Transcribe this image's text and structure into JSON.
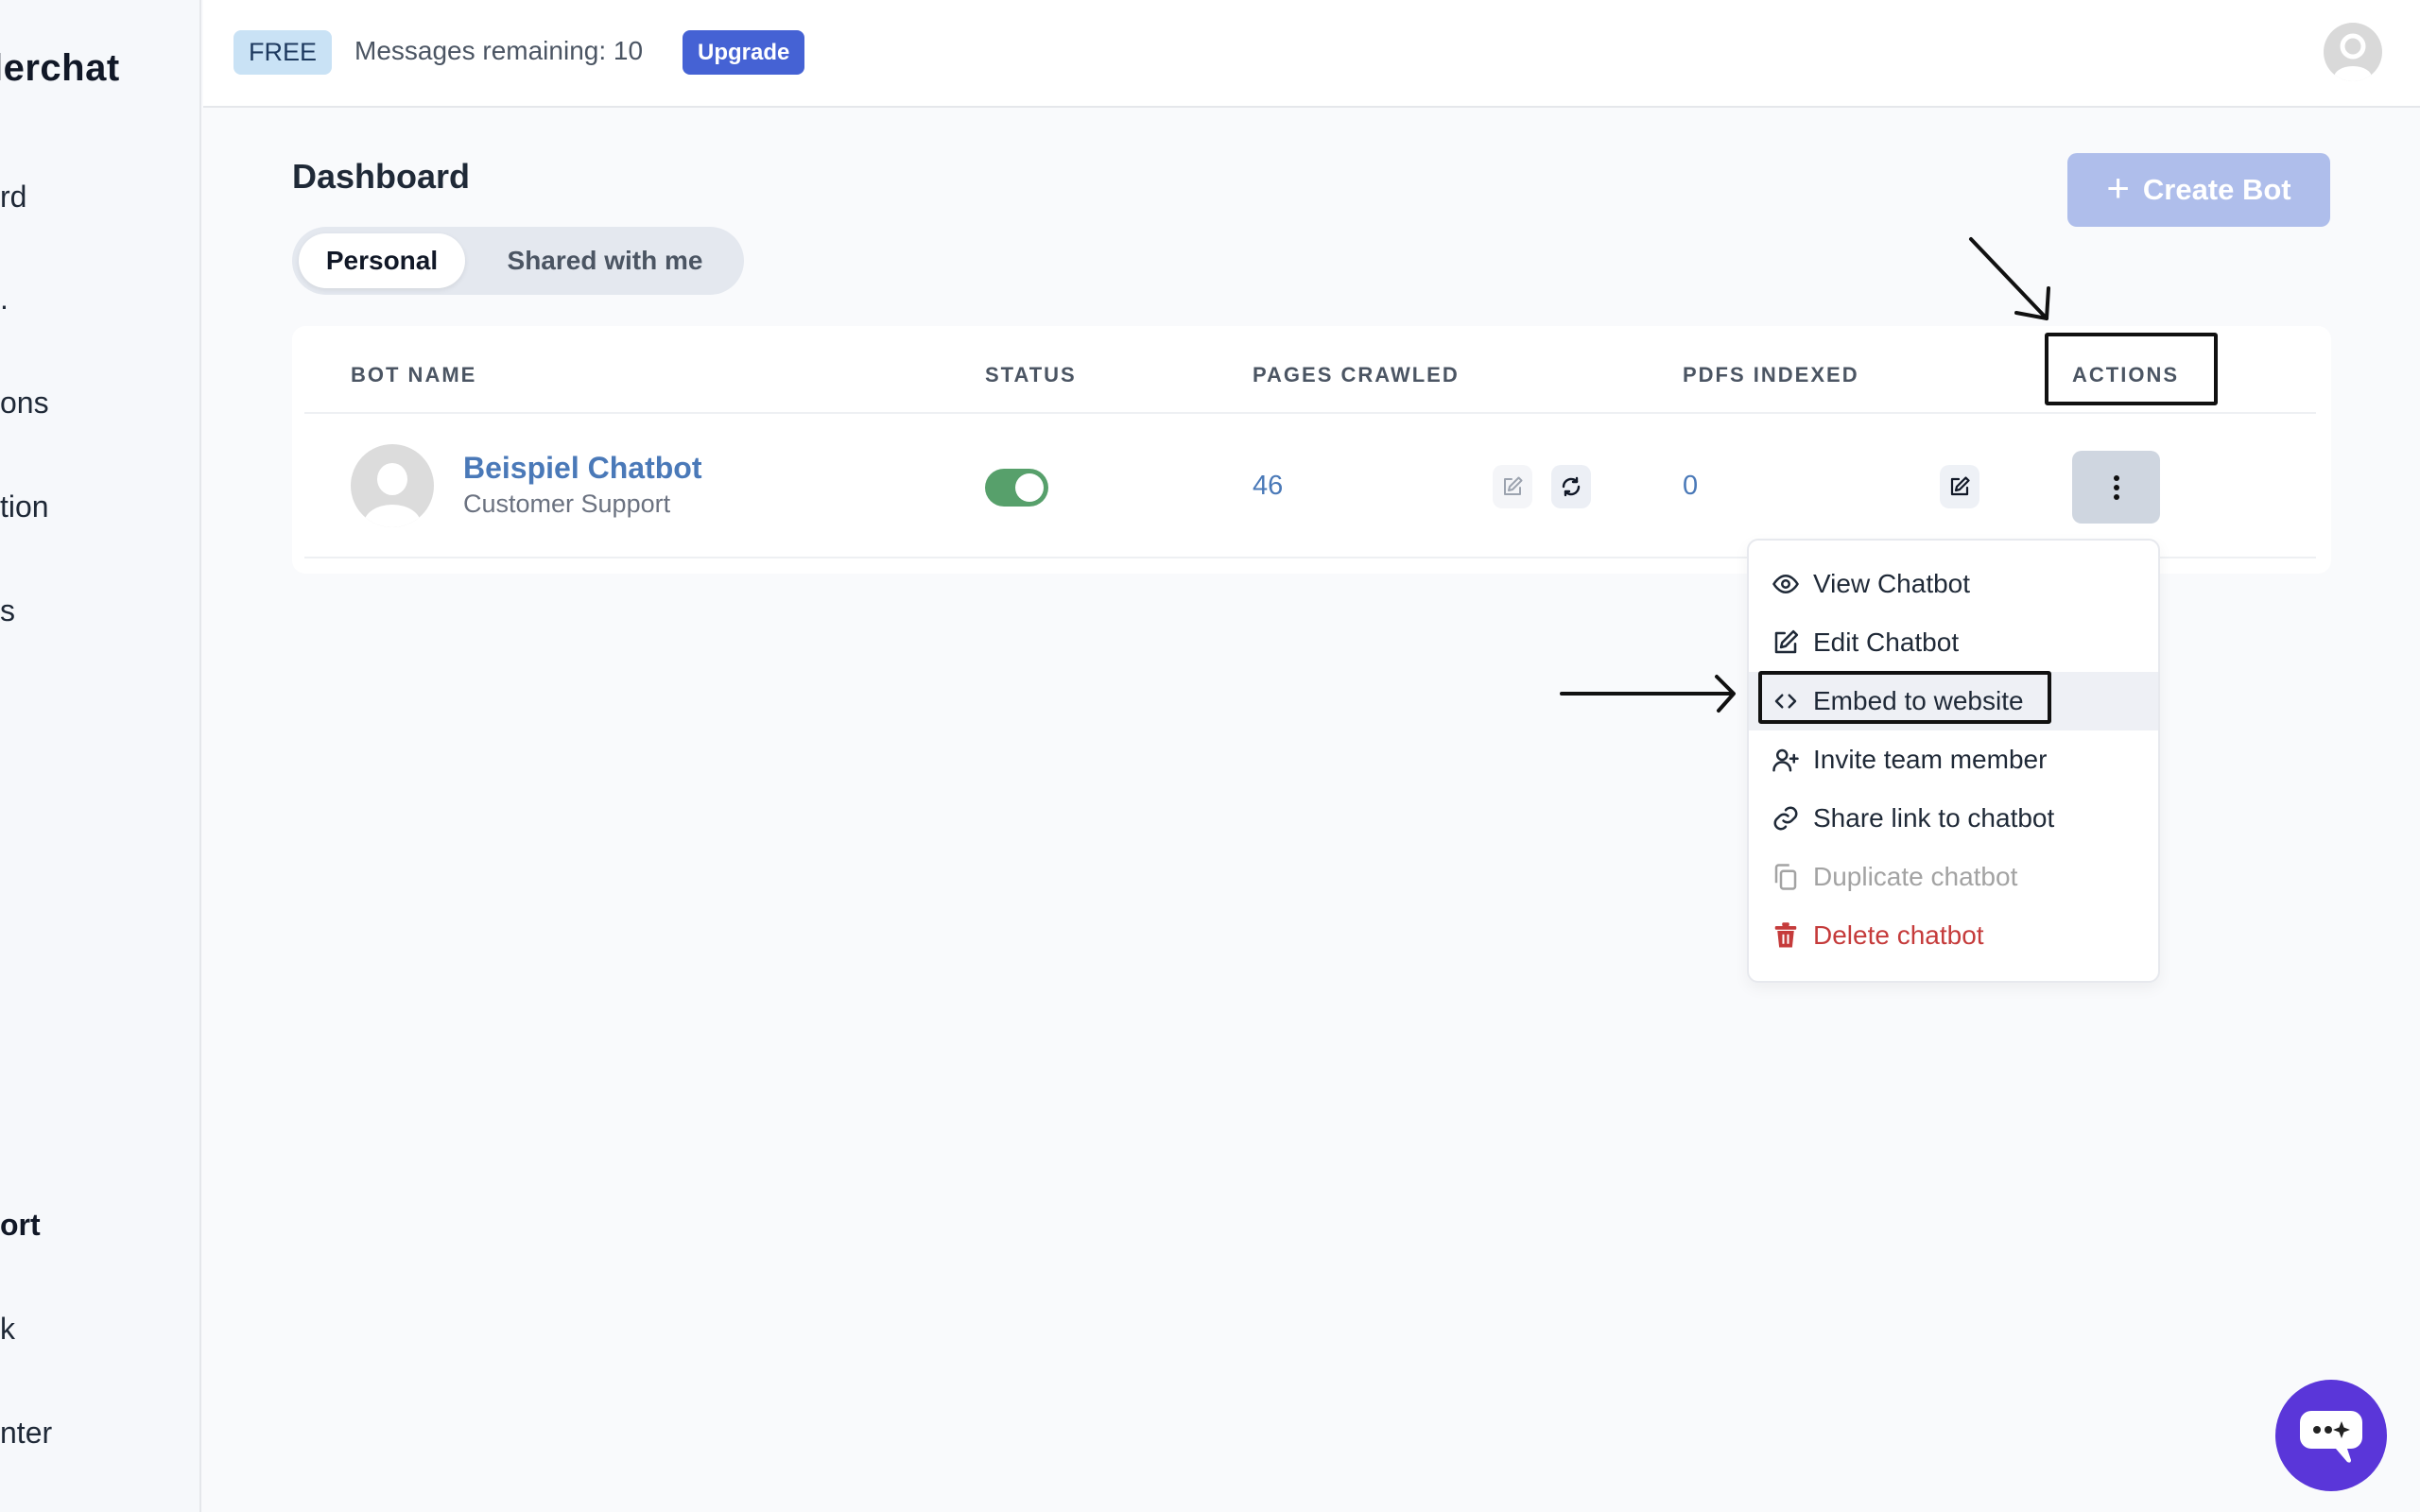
{
  "sidebar": {
    "brand": "lerchat",
    "items": [
      {
        "label": "rd"
      },
      {
        "label": "."
      },
      {
        "label": "ons"
      },
      {
        "label": "tion"
      },
      {
        "label": "s"
      }
    ],
    "support_heading": "ort",
    "support_items": [
      {
        "label": "k"
      },
      {
        "label": "nter"
      }
    ]
  },
  "topbar": {
    "plan_badge": "FREE",
    "messages_remaining": "Messages remaining: 10",
    "upgrade_label": "Upgrade",
    "avatar_icon": "user-avatar-icon"
  },
  "main": {
    "title": "Dashboard",
    "create_bot_label": "Create Bot",
    "create_bot_icon": "plus-icon",
    "tabs": [
      {
        "label": "Personal",
        "active": true
      },
      {
        "label": "Shared with me",
        "active": false
      }
    ],
    "table": {
      "columns": [
        "BOT NAME",
        "STATUS",
        "PAGES CRAWLED",
        "PDFS INDEXED",
        "ACTIONS"
      ],
      "rows": [
        {
          "name": "Beispiel Chatbot",
          "subtitle": "Customer Support",
          "status_enabled": true,
          "pages_crawled": "46",
          "pdfs_indexed": "0"
        }
      ]
    }
  },
  "actions_menu": {
    "items": [
      {
        "label": "View Chatbot",
        "icon": "eye-icon",
        "state": "normal"
      },
      {
        "label": "Edit Chatbot",
        "icon": "edit-icon",
        "state": "normal"
      },
      {
        "label": "Embed to website",
        "icon": "code-icon",
        "state": "hover"
      },
      {
        "label": "Invite team member",
        "icon": "user-plus-icon",
        "state": "normal"
      },
      {
        "label": "Share link to chatbot",
        "icon": "link-icon",
        "state": "normal"
      },
      {
        "label": "Duplicate chatbot",
        "icon": "copy-icon",
        "state": "disabled"
      },
      {
        "label": "Delete chatbot",
        "icon": "trash-icon",
        "state": "danger"
      }
    ]
  },
  "colors": {
    "accent": "#4562d4",
    "create_button": "#afbeeb",
    "link": "#4a79b8",
    "toggle_on": "#57a06b",
    "danger": "#c53b3b",
    "chat_fab": "#5a36d9"
  }
}
